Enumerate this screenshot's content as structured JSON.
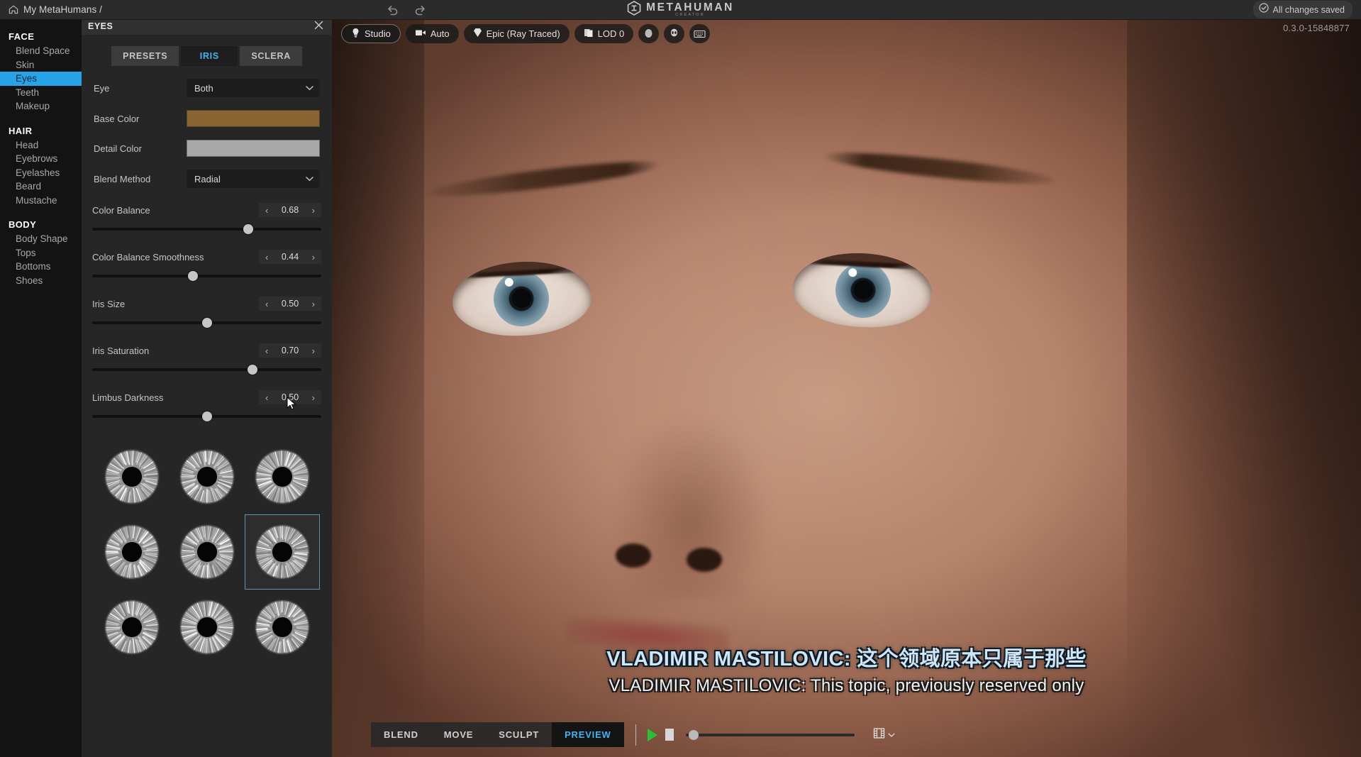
{
  "header": {
    "breadcrumb": "My MetaHumans /",
    "home_icon": "home-icon",
    "undo_icon": "undo-icon",
    "redo_icon": "redo-icon",
    "logo_word": "METAHUMAN",
    "logo_sub": "CREATOR",
    "saved_label": "All changes saved",
    "saved_icon": "check-circle-icon"
  },
  "sidebar": {
    "groups": [
      {
        "title": "FACE",
        "items": [
          "Blend Space",
          "Skin",
          "Eyes",
          "Teeth",
          "Makeup"
        ]
      },
      {
        "title": "HAIR",
        "items": [
          "Head",
          "Eyebrows",
          "Eyelashes",
          "Beard",
          "Mustache"
        ]
      },
      {
        "title": "BODY",
        "items": [
          "Body Shape",
          "Tops",
          "Bottoms",
          "Shoes"
        ]
      }
    ],
    "active_item": "Eyes",
    "active_color": "#29a3e8"
  },
  "panel": {
    "title": "EYES",
    "close_icon": "close-icon",
    "tabs": [
      {
        "label": "PRESETS",
        "active": false
      },
      {
        "label": "IRIS",
        "active": true
      },
      {
        "label": "SCLERA",
        "active": false
      }
    ],
    "active_tab_color": "#45b2f0",
    "fields": [
      {
        "label": "Eye",
        "type": "dropdown",
        "value": "Both"
      },
      {
        "label": "Base Color",
        "type": "color",
        "value": "#8a6534"
      },
      {
        "label": "Detail Color",
        "type": "color",
        "value": "#a8aaa9"
      },
      {
        "label": "Blend Method",
        "type": "dropdown",
        "value": "Radial"
      }
    ],
    "sliders": [
      {
        "label": "Color Balance",
        "value": "0.68",
        "fraction": 0.68
      },
      {
        "label": "Color Balance Smoothness",
        "value": "0.44",
        "fraction": 0.44
      },
      {
        "label": "Iris Size",
        "value": "0.50",
        "fraction": 0.5
      },
      {
        "label": "Iris Saturation",
        "value": "0.70",
        "fraction": 0.7
      },
      {
        "label": "Limbus Darkness",
        "value": "0.50",
        "fraction": 0.5
      }
    ],
    "stepper_left_icon": "chevron-left-icon",
    "stepper_right_icon": "chevron-right-icon",
    "thumbnails": {
      "count": 9,
      "selected_index": 5,
      "selected_border_color": "#5b93bb"
    }
  },
  "viewport": {
    "toolbar": [
      {
        "label": "Studio",
        "icon": "lightbulb-icon",
        "outlined": true
      },
      {
        "label": "Auto",
        "icon": "camera-icon",
        "outlined": false
      },
      {
        "label": "Epic (Ray Traced)",
        "icon": "diamond-icon",
        "outlined": false
      },
      {
        "label": "LOD 0",
        "icon": "layers-icon",
        "outlined": false
      }
    ],
    "icon_buttons": [
      "head-silhouette-icon",
      "body-silhouette-icon",
      "keyboard-icon"
    ],
    "version": "0.3.0-15848877"
  },
  "subtitles": {
    "line_cn": "VLADIMIR MASTILOVIC: 这个领域原本只属于那些",
    "line_en": "VLADIMIR MASTILOVIC: This topic, previously reserved only",
    "cn_color": "#cfe6f6",
    "en_color": "#f4f4f4"
  },
  "bottom_toolbar": {
    "modes": [
      {
        "label": "BLEND",
        "active": false
      },
      {
        "label": "MOVE",
        "active": false
      },
      {
        "label": "SCULPT",
        "active": false
      },
      {
        "label": "PREVIEW",
        "active": true
      }
    ],
    "active_mode_color": "#45b2f0",
    "play_icon": "play-icon",
    "stop_icon": "stop-icon",
    "scrub_fraction": 0.02,
    "filmstrip_icon": "filmstrip-icon",
    "filmstrip_chevron_icon": "chevron-down-icon"
  }
}
